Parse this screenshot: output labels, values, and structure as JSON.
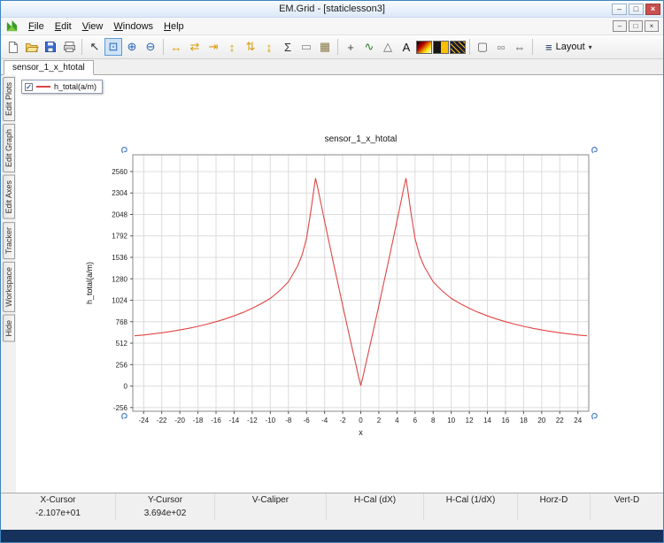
{
  "window": {
    "title": "EM.Grid - [staticlesson3]",
    "controls": {
      "minimize": "–",
      "maximize": "□",
      "close": "×"
    }
  },
  "menu": {
    "items": [
      "File",
      "Edit",
      "View",
      "Windows",
      "Help"
    ],
    "mdi_controls": {
      "minimize": "–",
      "restore": "□",
      "close": "×"
    }
  },
  "toolbar": {
    "buttons": [
      {
        "name": "new-file",
        "icon": "svg"
      },
      {
        "name": "open-file",
        "icon": "svg"
      },
      {
        "name": "save-file",
        "icon": "svg"
      },
      {
        "name": "print",
        "icon": "svg"
      },
      {
        "sep": true
      },
      {
        "name": "pointer-tool",
        "glyph": "↖",
        "color": "#333333"
      },
      {
        "name": "zoom-region-tool",
        "glyph": "⊡",
        "color": "#2266bb",
        "selected": true
      },
      {
        "name": "zoom-in-tool",
        "glyph": "⊕",
        "color": "#2266bb"
      },
      {
        "name": "zoom-out-tool",
        "glyph": "⊖",
        "color": "#2266bb"
      },
      {
        "sep": true
      },
      {
        "name": "expand-x-tool",
        "glyph": "↔",
        "color": "#dd9900"
      },
      {
        "name": "compress-x-tool",
        "glyph": "⇄",
        "color": "#dd9900"
      },
      {
        "name": "fit-x-tool",
        "glyph": "⇥",
        "color": "#dd9900"
      },
      {
        "name": "expand-y-tool",
        "glyph": "↕",
        "color": "#dd9900"
      },
      {
        "name": "compress-y-tool",
        "glyph": "⇅",
        "color": "#dd9900"
      },
      {
        "name": "fit-y-tool",
        "glyph": "↨",
        "color": "#dd9900"
      },
      {
        "name": "autoscale-tool",
        "glyph": "Σ",
        "color": "#333333"
      },
      {
        "name": "caliper-tool",
        "glyph": "▭",
        "color": "#888888"
      },
      {
        "name": "grid-tool",
        "glyph": "▦",
        "color": "#8a7a4a"
      },
      {
        "sep": true
      },
      {
        "name": "add-marker-tool",
        "glyph": "+",
        "color": "#444444"
      },
      {
        "name": "tracker-tool",
        "glyph": "∿",
        "color": "#2a7d2a"
      },
      {
        "name": "slope-tool",
        "glyph": "△",
        "color": "#666666"
      },
      {
        "name": "add-text-tool",
        "glyph": "A",
        "color": "#111111"
      },
      {
        "name": "colormap-tool",
        "img": "colormap"
      },
      {
        "name": "intensity-tool",
        "img": "intensity"
      },
      {
        "name": "contour-tool",
        "img": "contour"
      },
      {
        "sep": true
      },
      {
        "name": "h-caliper-toggle",
        "glyph": "▢",
        "color": "#555555"
      },
      {
        "name": "v-caliper-toggle",
        "glyph": "▫▫",
        "color": "#555555"
      },
      {
        "name": "width-toggle",
        "glyph": "⇔",
        "color": "#555555"
      },
      {
        "sep": true
      }
    ],
    "layout": {
      "bars": "≡",
      "label": "Layout",
      "caret": "▾"
    }
  },
  "tab": {
    "label": "sensor_1_x_htotal"
  },
  "side_tabs": [
    "Edit Plots",
    "Edit Graph",
    "Edit Axes",
    "Tracker",
    "Workspace",
    "Hide"
  ],
  "legend": {
    "checked": true,
    "check": "✓",
    "label": "h_total(a/m)",
    "color": "#e04545"
  },
  "chart_data": {
    "type": "line",
    "title": "sensor_1_x_htotal",
    "xlabel": "x",
    "ylabel": "h_total(a/m)",
    "xlim": [
      -25.2,
      25.2
    ],
    "ylim": [
      -300,
      2760
    ],
    "xticks": [
      -24,
      -22,
      -20,
      -18,
      -16,
      -14,
      -12,
      -10,
      -8,
      -6,
      -4,
      -2,
      0,
      2,
      4,
      6,
      8,
      10,
      12,
      14,
      16,
      18,
      20,
      22,
      24
    ],
    "yticks": [
      -256,
      0,
      256,
      512,
      768,
      1024,
      1280,
      1536,
      1792,
      2048,
      2304,
      2560
    ],
    "grid": true,
    "legend_position": "floating-top-left",
    "series": [
      {
        "name": "h_total(a/m)",
        "color": "#e04545",
        "x": [
          -25,
          -24,
          -23,
          -22,
          -21,
          -20,
          -19,
          -18,
          -17,
          -16,
          -15,
          -14,
          -13,
          -12,
          -11,
          -10,
          -9,
          -8,
          -7,
          -6.5,
          -6,
          -5.5,
          -5.25,
          -5,
          -4.75,
          -4.5,
          -4,
          -3.5,
          -3,
          -2.5,
          -2,
          -1.5,
          -1,
          -0.5,
          -0.25,
          0,
          0.25,
          0.5,
          1,
          1.5,
          2,
          2.5,
          3,
          3.5,
          4,
          4.5,
          4.75,
          5,
          5.25,
          5.5,
          6,
          6.5,
          7,
          8,
          9,
          10,
          11,
          12,
          13,
          14,
          15,
          16,
          17,
          18,
          19,
          20,
          21,
          22,
          23,
          24,
          25
        ],
        "y": [
          600,
          610,
          622,
          636,
          652,
          670,
          690,
          713,
          739,
          768,
          801,
          838,
          880,
          928,
          983,
          1046,
          1135,
          1245,
          1430,
          1560,
          1760,
          2100,
          2300,
          2480,
          2360,
          2230,
          1970,
          1715,
          1460,
          1210,
          960,
          715,
          475,
          237,
          118,
          5,
          118,
          237,
          475,
          715,
          960,
          1210,
          1460,
          1715,
          1970,
          2230,
          2360,
          2480,
          2300,
          2100,
          1760,
          1560,
          1430,
          1245,
          1135,
          1046,
          983,
          928,
          880,
          838,
          801,
          768,
          739,
          713,
          690,
          670,
          652,
          636,
          622,
          610,
          600
        ]
      }
    ]
  },
  "status_bar": {
    "columns": [
      {
        "label": "X-Cursor",
        "value": "-2.107e+01"
      },
      {
        "label": "Y-Cursor",
        "value": "3.694e+02"
      },
      {
        "label": "V-Caliper",
        "value": ""
      },
      {
        "label": "H-Cal (dX)",
        "value": ""
      },
      {
        "label": "H-Cal (1/dX)",
        "value": ""
      },
      {
        "label": "Horz-D",
        "value": ""
      },
      {
        "label": "Vert-D",
        "value": ""
      }
    ]
  }
}
